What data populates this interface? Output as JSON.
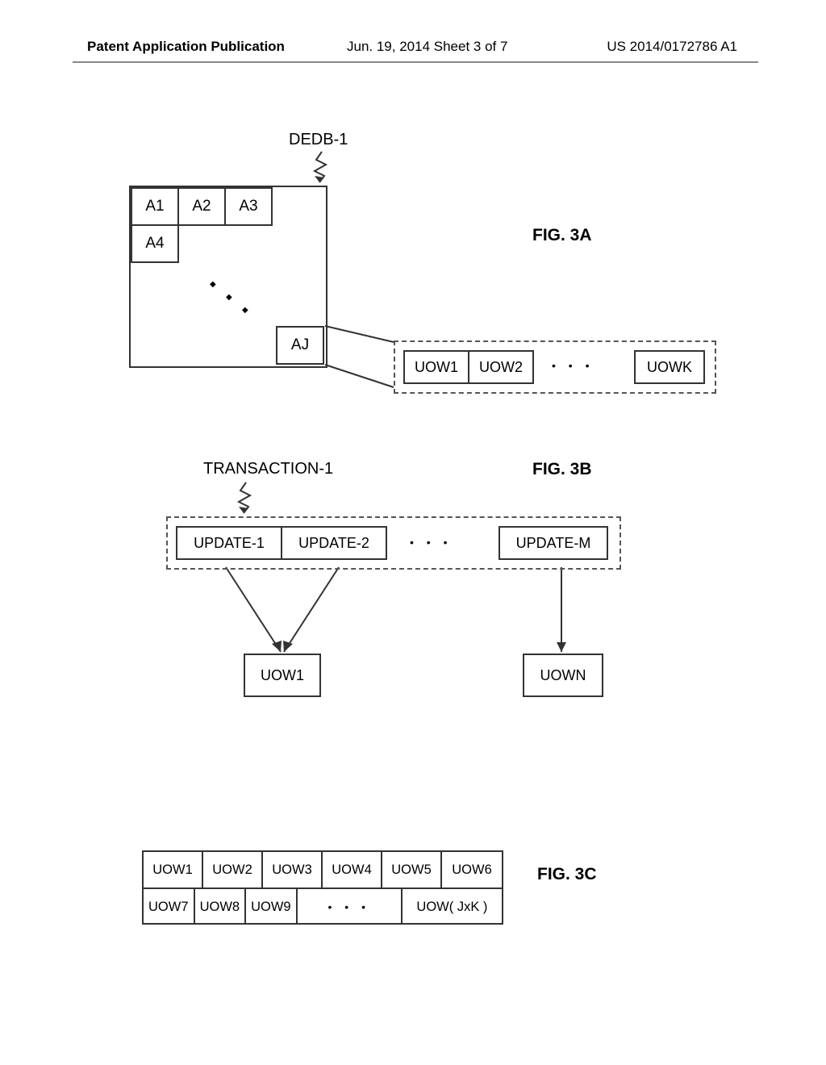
{
  "header": {
    "left": "Patent Application Publication",
    "middle": "Jun. 19, 2014  Sheet 3 of 7",
    "right": "US 2014/0172786 A1"
  },
  "fig3a": {
    "dedb_label": "DEDB-1",
    "cells": {
      "a1": "A1",
      "a2": "A2",
      "a3": "A3",
      "a4": "A4",
      "aj": "AJ"
    },
    "uows": {
      "u1": "UOW1",
      "u2": "UOW2",
      "uk": "UOWK"
    },
    "ellipsis": "• • •",
    "label": "FIG. 3A"
  },
  "fig3b": {
    "trans_label": "TRANSACTION-1",
    "updates": {
      "u1": "UPDATE-1",
      "u2": "UPDATE-2",
      "um": "UPDATE-M"
    },
    "ellipsis": "• • •",
    "targets": {
      "uow1": "UOW1",
      "uown": "UOWN"
    },
    "label": "FIG. 3B"
  },
  "fig3c": {
    "row1": {
      "c1": "UOW1",
      "c2": "UOW2",
      "c3": "UOW3",
      "c4": "UOW4",
      "c5": "UOW5",
      "c6": "UOW6"
    },
    "row2": {
      "c1": "UOW7",
      "c2": "UOW8",
      "c3": "UOW9",
      "ellipsis": "• • •",
      "last": "UOW( JxK )"
    },
    "label": "FIG. 3C"
  }
}
